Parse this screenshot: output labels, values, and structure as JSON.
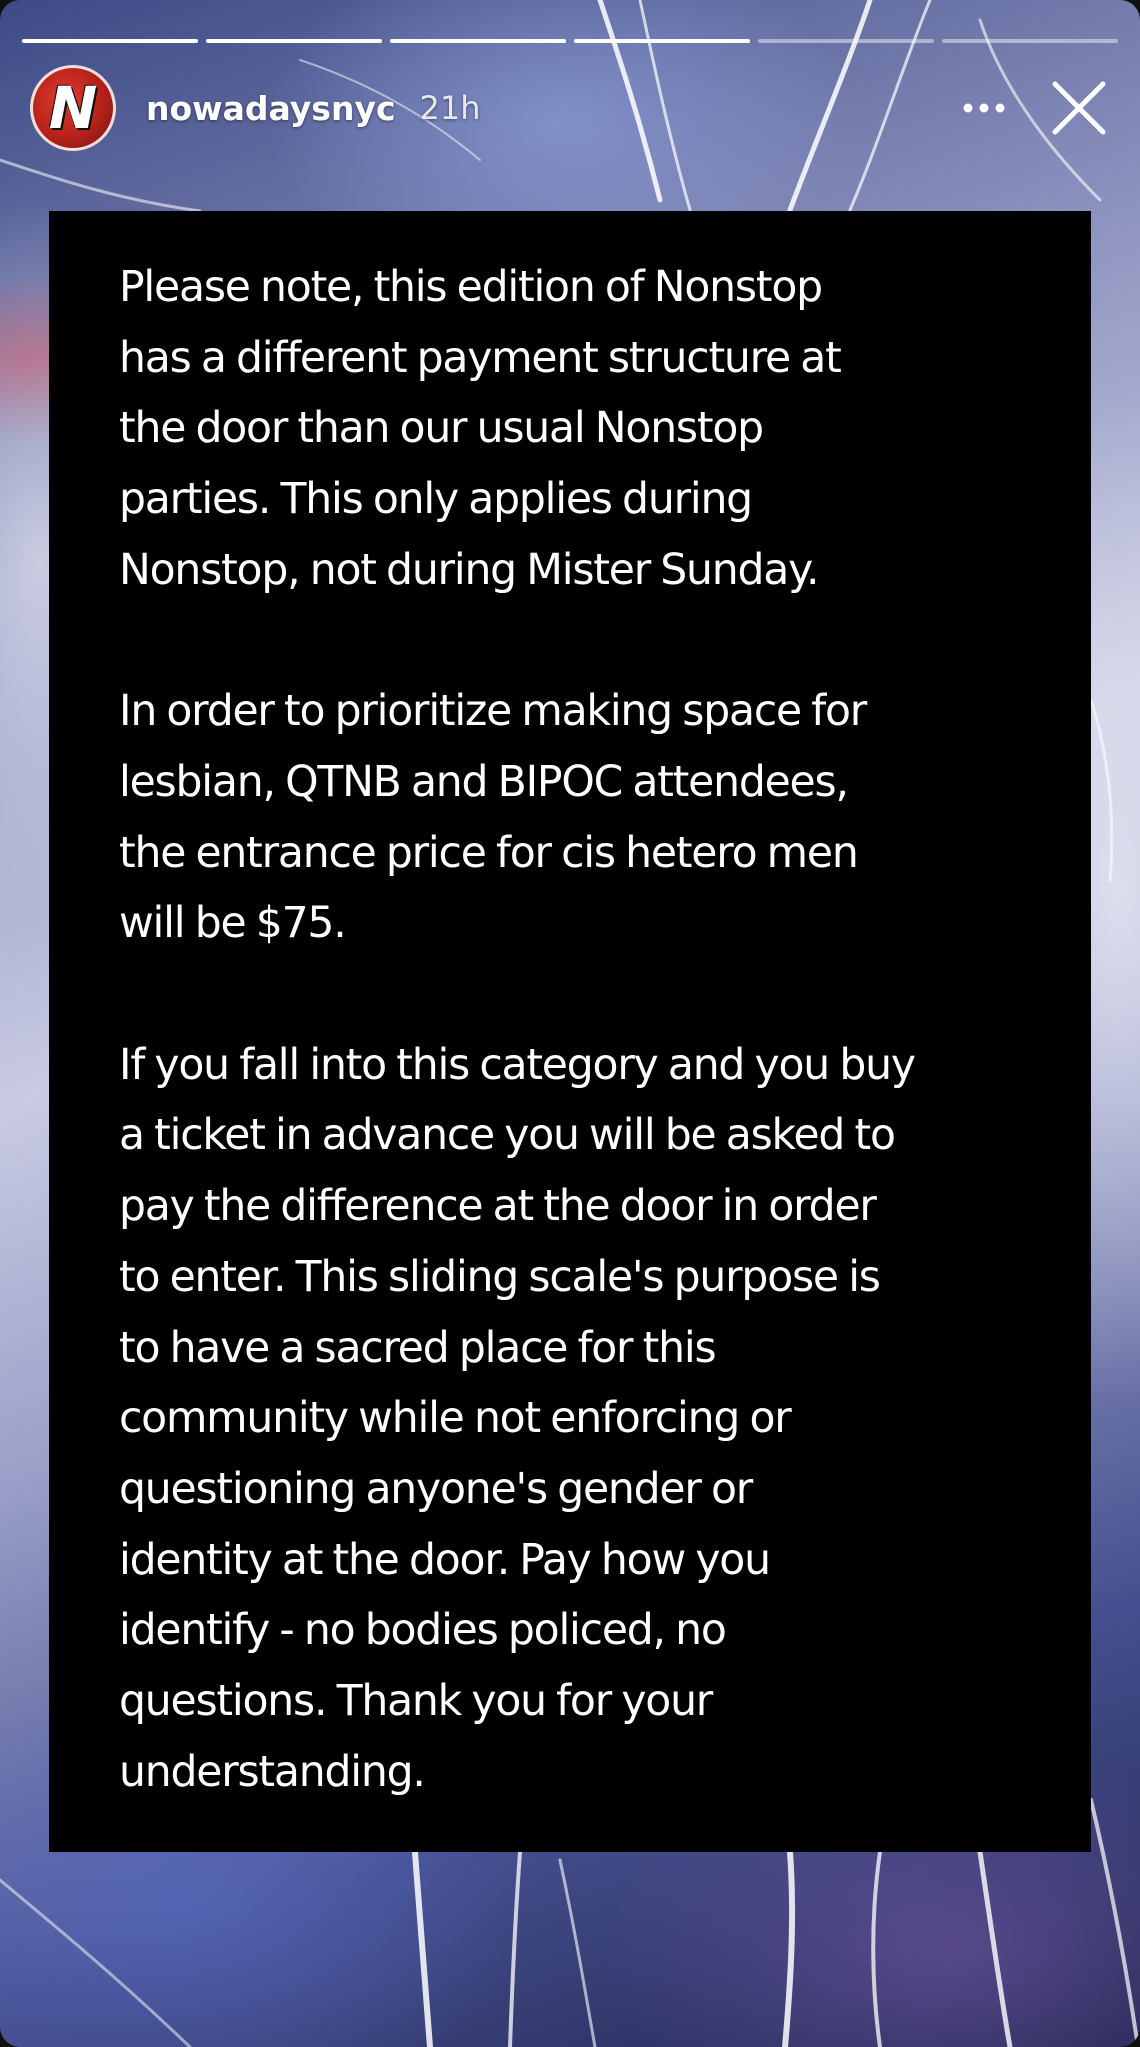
{
  "story": {
    "progress_segments": [
      1,
      1,
      1,
      1,
      0,
      0
    ],
    "account": {
      "username": "nowadaysnyc",
      "time_ago": "21h",
      "avatar_letter": "N"
    },
    "icons": {
      "more": "more-options-icon",
      "close": "close-icon"
    },
    "colors": {
      "card_background": "#000000",
      "text": "#ffffff",
      "avatar_red": "#d22b22"
    }
  },
  "notice": {
    "paragraphs": [
      {
        "lines": [
          "Please note, this edition of Nonstop",
          "has a different payment structure at",
          "the door than our usual Nonstop",
          "parties. This only applies during",
          "Nonstop, not during Mister Sunday."
        ]
      },
      {
        "lines": [
          "In order to prioritize making space for",
          "lesbian, QTNB and BIPOC attendees,",
          "the entrance price for cis hetero men",
          "will be $75."
        ]
      },
      {
        "lines": [
          "If you fall into this category and you buy",
          "a ticket in advance you will be asked to",
          "pay the difference at the door in order",
          "to enter. This sliding scale's purpose is",
          "to have a sacred place for this",
          "community while not enforcing or",
          "questioning anyone's gender or",
          "identity at the door. Pay how you",
          "identify - no bodies policed, no",
          "questions. Thank you for your",
          "understanding."
        ]
      }
    ]
  }
}
